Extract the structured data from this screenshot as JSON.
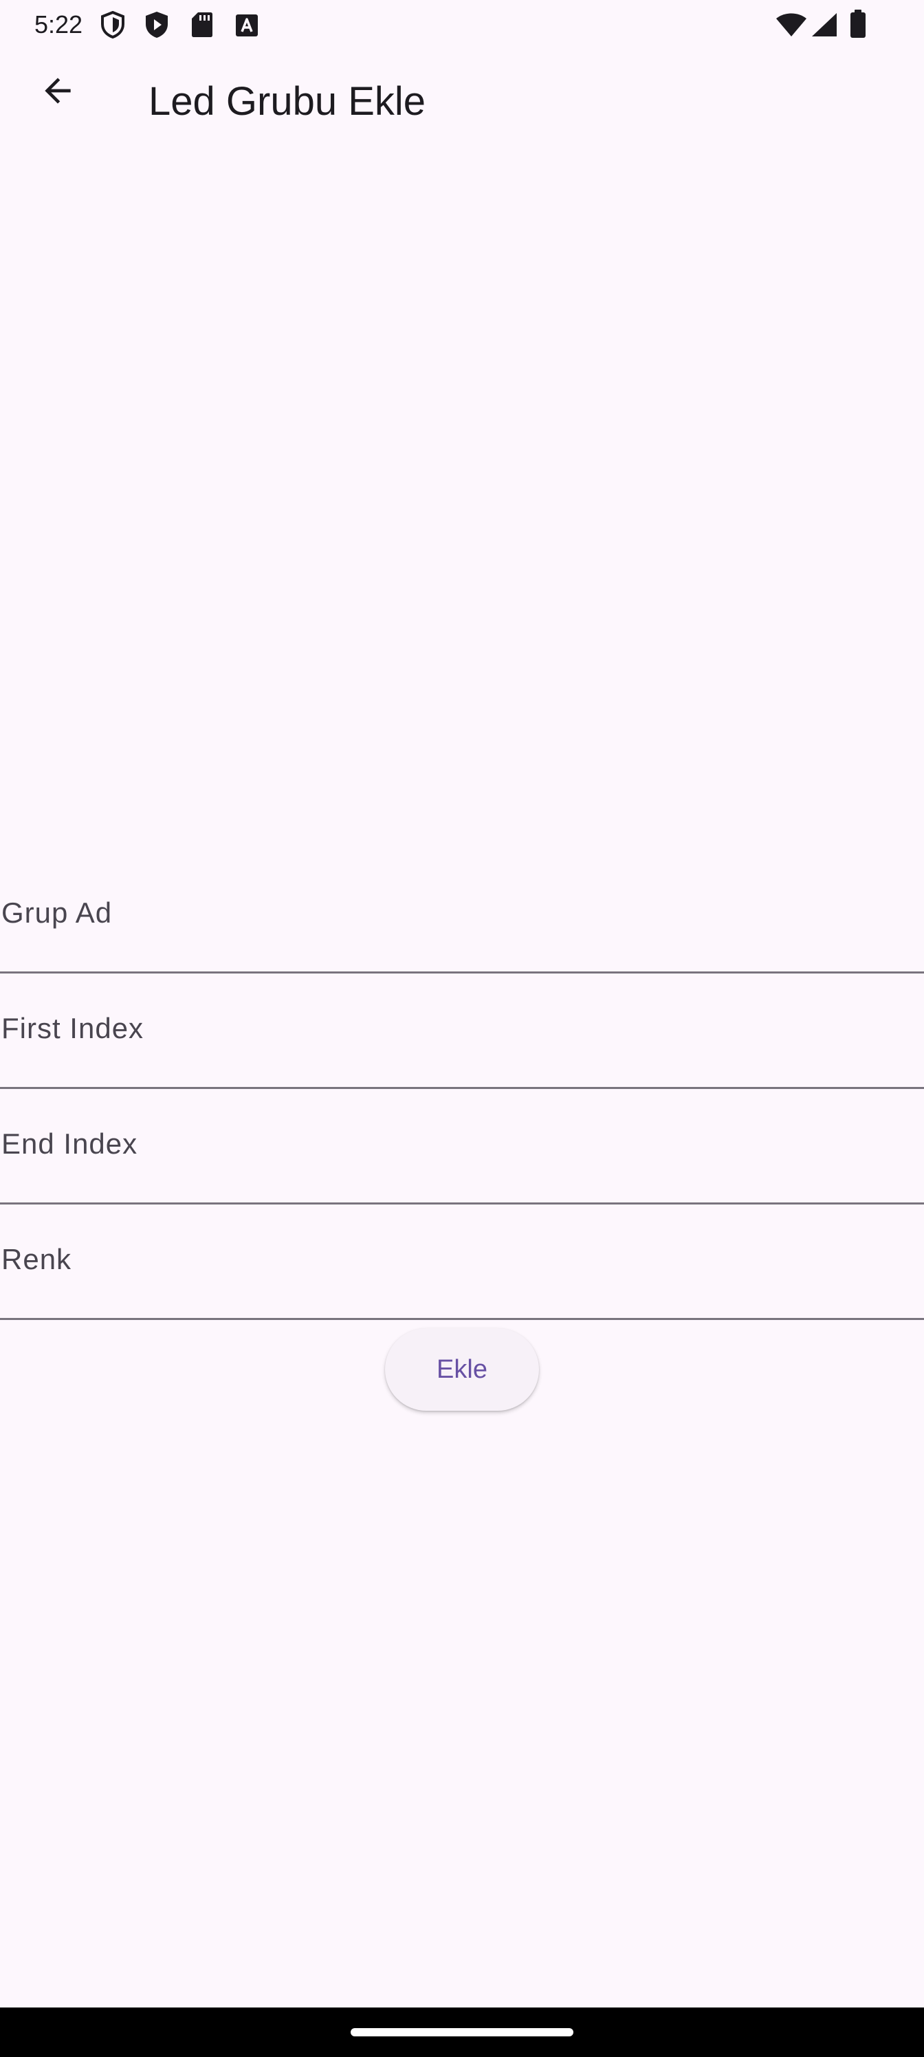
{
  "status_bar": {
    "time": "5:22",
    "left_icons": [
      "shield-icon",
      "play-protect-icon",
      "sd-card-icon",
      "keyboard-a-icon"
    ],
    "right_icons": [
      "wifi-icon",
      "signal-icon",
      "battery-icon"
    ]
  },
  "app_bar": {
    "back_icon": "arrow-back-icon",
    "title": "Led Grubu Ekle"
  },
  "form": {
    "fields": [
      {
        "label": "Grup Ad",
        "value": ""
      },
      {
        "label": "First Index",
        "value": ""
      },
      {
        "label": "End Index",
        "value": ""
      },
      {
        "label": "Renk",
        "value": ""
      }
    ],
    "submit_label": "Ekle"
  },
  "colors": {
    "background": "#FDF7FD",
    "accent": "#6750A4",
    "divider": "#79747E",
    "nav_bar": "#000000"
  }
}
